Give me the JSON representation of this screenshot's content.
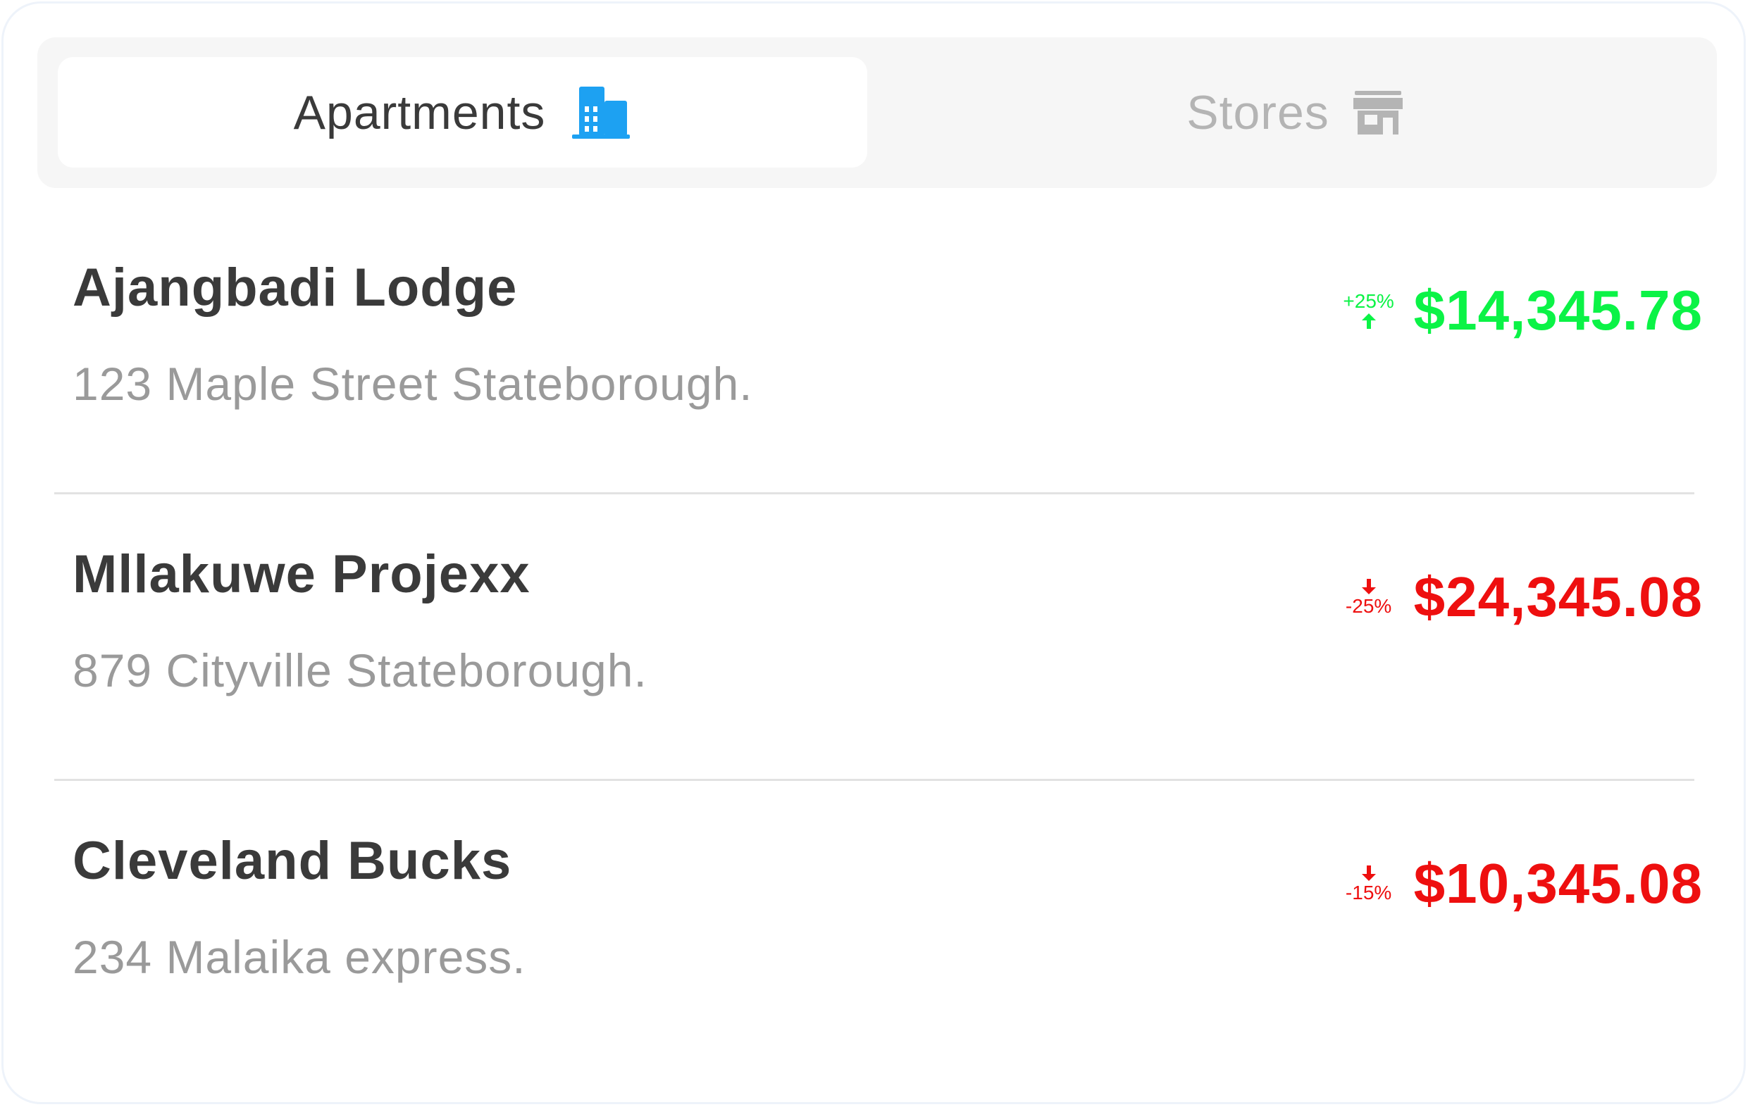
{
  "tabs": [
    {
      "label": "Apartments",
      "icon": "building-icon",
      "active": true,
      "color": "#1da1f2"
    },
    {
      "label": "Stores",
      "icon": "store-icon",
      "active": false,
      "color": "#b4b4b4"
    }
  ],
  "properties": [
    {
      "name": "Ajangbadi Lodge",
      "address": "123 Maple Street Stateborough.",
      "change": "+25%",
      "direction": "up",
      "amount": "$14,345.78"
    },
    {
      "name": "Mllakuwe Projexx",
      "address": "879 Cityville Stateborough.",
      "change": "-25%",
      "direction": "down",
      "amount": "$24,345.08"
    },
    {
      "name": "Cleveland Bucks",
      "address": "234 Malaika express.",
      "change": "-15%",
      "direction": "down",
      "amount": "$10,345.08"
    }
  ],
  "colors": {
    "up": "#0bf346",
    "down": "#ee0f0f",
    "active_tab_text": "#3a3a3a",
    "inactive_tab_text": "#b4b4b4"
  }
}
